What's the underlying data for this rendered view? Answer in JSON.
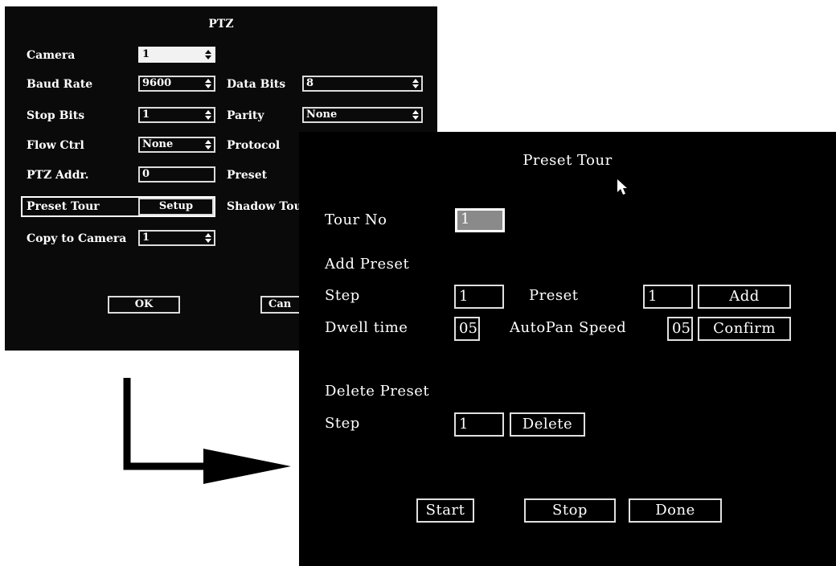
{
  "ptz": {
    "title": "PTZ",
    "camera_label": "Camera",
    "camera_value": "1",
    "baud_rate_label": "Baud Rate",
    "baud_rate_value": "9600",
    "data_bits_label": "Data Bits",
    "data_bits_value": "8",
    "stop_bits_label": "Stop Bits",
    "stop_bits_value": "1",
    "parity_label": "Parity",
    "parity_value": "None",
    "flow_ctrl_label": "Flow Ctrl",
    "flow_ctrl_value": "None",
    "protocol_label": "Protocol",
    "ptz_addr_label": "PTZ Addr.",
    "ptz_addr_value": "0",
    "preset_label": "Preset",
    "preset_tour_label": "Preset Tour",
    "setup_label": "Setup",
    "shadow_tour_label": "Shadow Tou",
    "copy_to_camera_label": "Copy to Camera",
    "copy_to_camera_value": "1",
    "ok_label": "OK",
    "cancel_label": "Can"
  },
  "tour": {
    "title": "Preset Tour",
    "tour_no_label": "Tour No",
    "tour_no_value": "1",
    "add_preset_heading": "Add Preset",
    "step_label": "Step",
    "step_value": "1",
    "preset_label": "Preset",
    "preset_value": "1",
    "add_label": "Add",
    "dwell_time_label": "Dwell time",
    "dwell_time_value": "05",
    "autopan_speed_label": "AutoPan Speed",
    "autopan_speed_value": "05",
    "confirm_label": "Confirm",
    "delete_preset_heading": "Delete Preset",
    "delete_step_label": "Step",
    "delete_step_value": "1",
    "delete_label": "Delete",
    "start_label": "Start",
    "stop_label": "Stop",
    "done_label": "Done"
  },
  "icons": {
    "cursor": "mouse-pointer-icon",
    "arrow": "elbow-arrow-icon",
    "spinner": "up-down-spinner-icon"
  },
  "colors": {
    "window_bg": "#0a0a0a",
    "field_border": "#dcdcdc",
    "highlight_field": "#8a8a8a",
    "page_bg": "#ffffff"
  }
}
